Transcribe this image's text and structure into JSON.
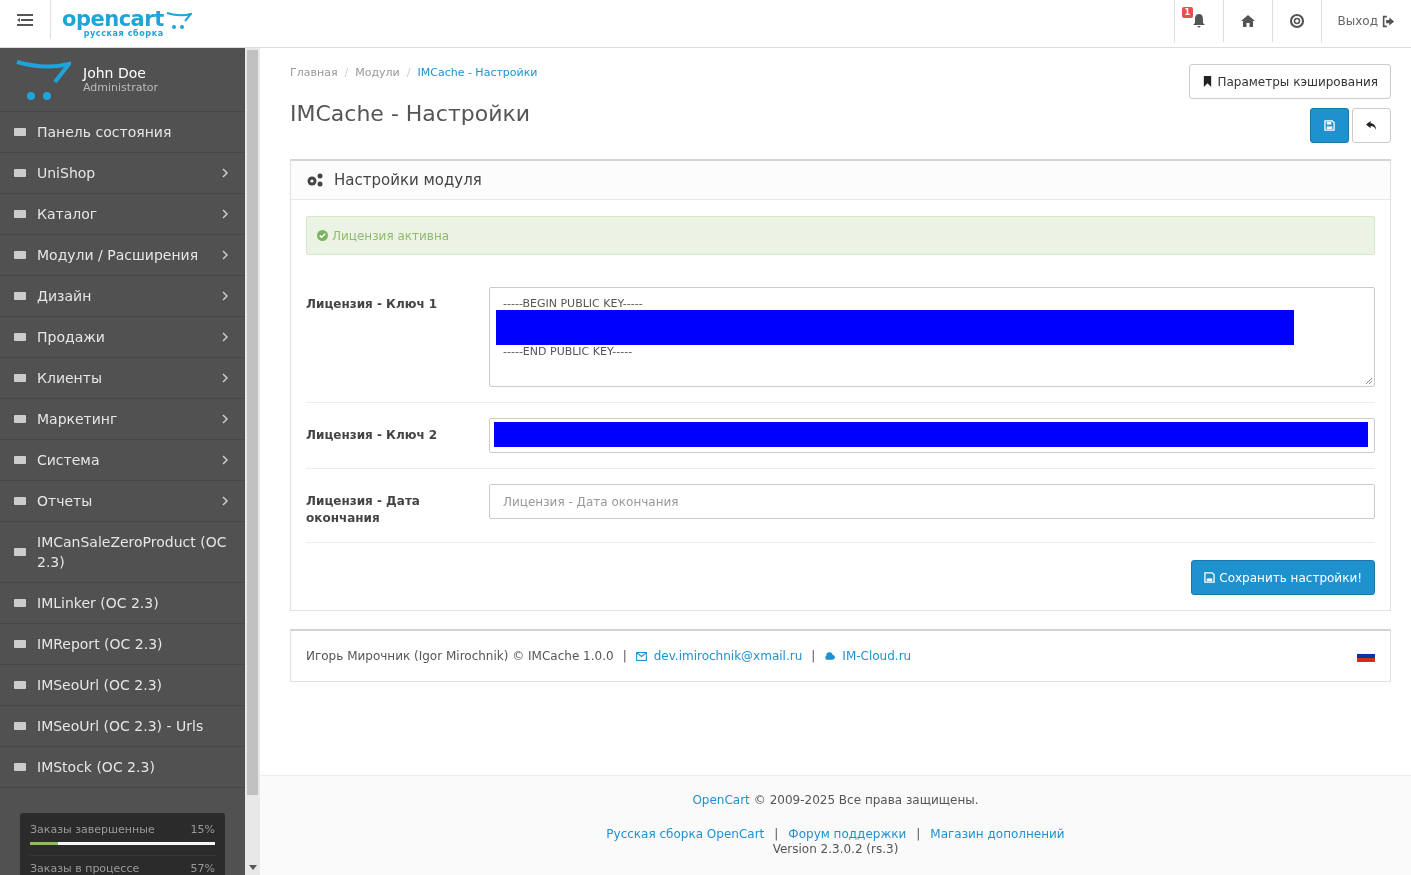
{
  "header": {
    "logo": {
      "wordmark": "opencart",
      "subtitle": "русская сборка"
    },
    "notification_count": "1",
    "logout": "Выход"
  },
  "sidebar": {
    "profile": {
      "name": "John Doe",
      "role": "Administrator"
    },
    "items": [
      {
        "label": "Панель состояния",
        "expandable": false
      },
      {
        "label": "UniShop",
        "expandable": true
      },
      {
        "label": "Каталог",
        "expandable": true
      },
      {
        "label": "Модули / Расширения",
        "expandable": true
      },
      {
        "label": "Дизайн",
        "expandable": true
      },
      {
        "label": "Продажи",
        "expandable": true
      },
      {
        "label": "Клиенты",
        "expandable": true
      },
      {
        "label": "Маркетинг",
        "expandable": true
      },
      {
        "label": "Система",
        "expandable": true
      },
      {
        "label": "Отчеты",
        "expandable": true
      },
      {
        "label": "IMCanSaleZeroProduct (OC 2.3)",
        "expandable": false
      },
      {
        "label": "IMLinker (OC 2.3)",
        "expandable": false
      },
      {
        "label": "IMReport (OC 2.3)",
        "expandable": false
      },
      {
        "label": "IMSeoUrl (OC 2.3)",
        "expandable": false
      },
      {
        "label": "IMSeoUrl (OC 2.3) - Urls",
        "expandable": false
      },
      {
        "label": "IMStock (OC 2.3)",
        "expandable": false
      }
    ],
    "stats": [
      {
        "label": "Заказы завершенные",
        "reading": "15%",
        "level": 0.15
      },
      {
        "label": "Заказы в процессе",
        "reading": "57%"
      }
    ]
  },
  "breadcrumb_separator": "/",
  "breadcrumb": [
    {
      "label": "Главная",
      "selected": false
    },
    {
      "label": "Модули",
      "selected": false
    },
    {
      "label": "IMCache - Настройки",
      "selected": true
    }
  ],
  "page_title": "IMCache - Настройки",
  "cache_button": "Параметры кэширования",
  "panel": {
    "title": "Настройки модуля",
    "alert": "Лицензия активна",
    "fields": [
      {
        "label": "Лицензия - Ключ 1",
        "kind": "textarea",
        "lines": [
          {
            "kind": "text",
            "text": "-----BEGIN PUBLIC KEY-----"
          },
          {
            "kind": "redacted"
          },
          {
            "kind": "text",
            "text": "-----END PUBLIC KEY-----"
          }
        ]
      },
      {
        "label": "Лицензия - Ключ 2",
        "kind": "redacted"
      },
      {
        "label": "Лицензия - Дата окончания",
        "kind": "input",
        "placeholder": "Лицензия - Дата окончания"
      }
    ],
    "save_button": "Сохранить настройки!"
  },
  "credits": {
    "author": "Игорь Мирочник (Igor Mirochnik) © IMCache 1.0.0",
    "separator": "|",
    "email": "dev.imirochnik@xmail.ru",
    "site": "IM-Cloud.ru"
  },
  "footer": {
    "brand_link": "OpenCart",
    "copyright": "© 2009-2025 Все права защищены.",
    "links": [
      "Русская сборка OpenCart",
      "Форум поддержки",
      "Магазин дополнений"
    ],
    "separator": "|",
    "version": "Version 2.3.0.2 (rs.3)"
  }
}
